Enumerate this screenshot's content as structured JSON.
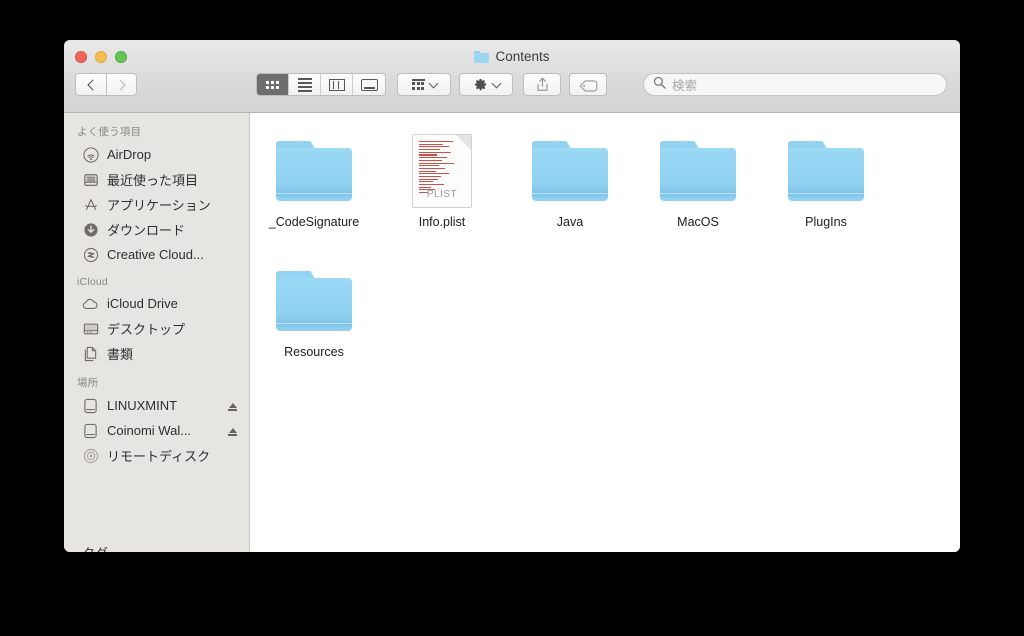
{
  "window": {
    "title": "Contents",
    "title_icon": "folder-icon",
    "traffic_lights": [
      {
        "name": "close",
        "color": "#f0665c"
      },
      {
        "name": "minimize",
        "color": "#f6bd4f"
      },
      {
        "name": "maximize",
        "color": "#62c554"
      }
    ]
  },
  "toolbar": {
    "back_label": "Back",
    "forward_label": "Forward",
    "view_buttons": [
      {
        "name": "icon-view",
        "active": true
      },
      {
        "name": "list-view",
        "active": false
      },
      {
        "name": "column-view",
        "active": false
      },
      {
        "name": "coverflow-view",
        "active": false
      }
    ],
    "arrange_label": "Arrange",
    "action_label": "Action",
    "share_label": "Share",
    "tag_label": "Tags"
  },
  "search": {
    "placeholder": "検索",
    "value": ""
  },
  "sidebar": {
    "sections": [
      {
        "title": "よく使う項目",
        "items": [
          {
            "label": "AirDrop",
            "icon": "airdrop-icon",
            "eject": false
          },
          {
            "label": "最近使った項目",
            "icon": "recents-icon",
            "eject": false
          },
          {
            "label": "アプリケーション",
            "icon": "applications-icon",
            "eject": false
          },
          {
            "label": "ダウンロード",
            "icon": "downloads-icon",
            "eject": false
          },
          {
            "label": "Creative Cloud...",
            "icon": "creative-cloud-icon",
            "eject": false
          }
        ]
      },
      {
        "title": "iCloud",
        "items": [
          {
            "label": "iCloud Drive",
            "icon": "cloud-icon",
            "eject": false
          },
          {
            "label": "デスクトップ",
            "icon": "desktop-icon",
            "eject": false
          },
          {
            "label": "書類",
            "icon": "documents-icon",
            "eject": false
          }
        ]
      },
      {
        "title": "場所",
        "items": [
          {
            "label": "LINUXMINT",
            "icon": "drive-icon",
            "eject": true
          },
          {
            "label": "Coinomi Wal...",
            "icon": "drive-icon",
            "eject": true
          },
          {
            "label": "リモートディスク",
            "icon": "remote-disc-icon",
            "eject": false
          }
        ]
      }
    ],
    "clipped_text": "タグ"
  },
  "content": {
    "files": [
      {
        "label": "_CodeSignature",
        "type": "folder"
      },
      {
        "label": "Info.plist",
        "type": "document",
        "kind": "PLIST"
      },
      {
        "label": "Java",
        "type": "folder"
      },
      {
        "label": "MacOS",
        "type": "folder"
      },
      {
        "label": "PlugIns",
        "type": "folder"
      },
      {
        "label": "Resources",
        "type": "folder"
      }
    ]
  },
  "colors": {
    "folder_blue": "#8ed0f0",
    "sidebar_bg": "#e7e5e2",
    "toolbar_bg": "#dcdcdc",
    "content_bg": "#ffffff",
    "desktop_bg": "#000000"
  }
}
